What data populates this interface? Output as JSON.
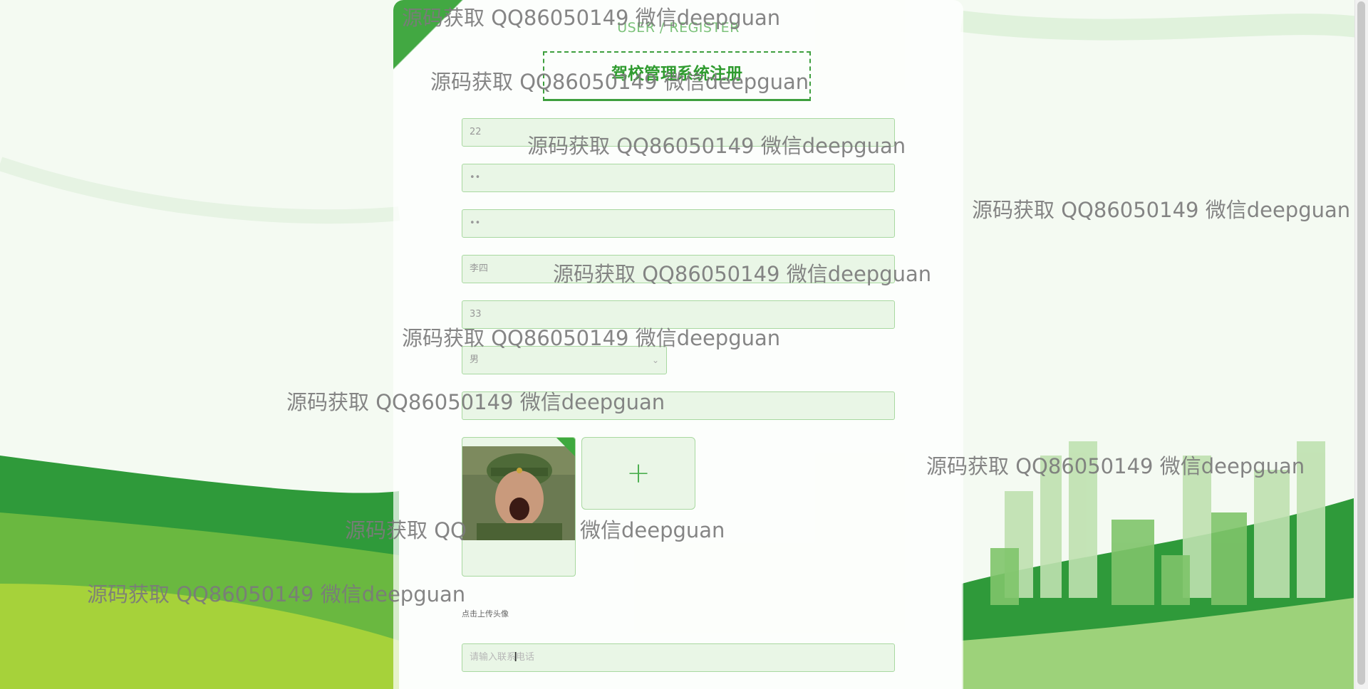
{
  "header": {
    "subtitle": "USER / REGISTER",
    "title": "驾校管理系统注册"
  },
  "form": {
    "account": "22",
    "password": "••",
    "confirm_password": "••",
    "name": "李四",
    "age": "33",
    "gender": "男",
    "field7": "",
    "avatar_hint": "点击上传头像",
    "phone_placeholder": "请输入联系电话"
  },
  "upload": {
    "add_symbol": "+"
  },
  "watermark": "源码获取 QQ86050149 微信deepguan",
  "watermark_fragments": {
    "left": "源码获取 QQ",
    "right": "微信deepguan"
  },
  "colors": {
    "accent": "#3e9f3e",
    "field_bg": "#e9f6e6",
    "border": "#a8d8a0"
  }
}
